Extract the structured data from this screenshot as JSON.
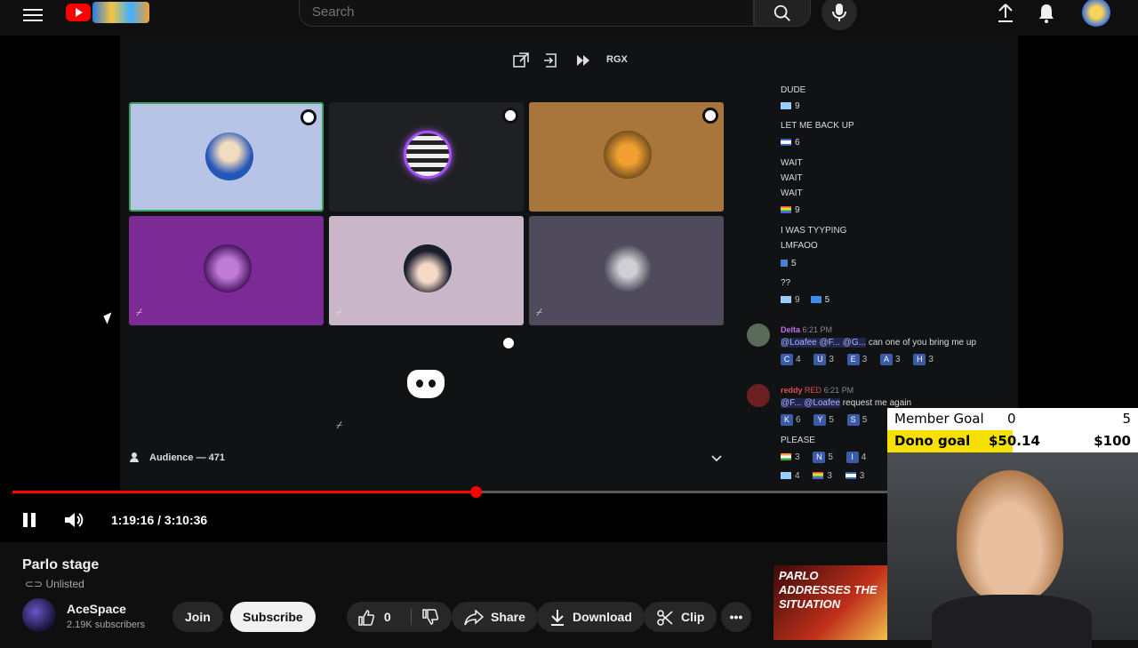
{
  "header": {
    "search_placeholder": "Search"
  },
  "discord": {
    "toolbar_label": "RGX",
    "audience_label": "Audience — 471",
    "tile_colors": [
      "#b8c4e6",
      "#1f2023",
      "#a8753a",
      "#7b2a96",
      "#c9b6c8",
      "#4f4b5c"
    ]
  },
  "chat": {
    "lines": [
      {
        "text": "DUDE"
      },
      {
        "count": "9"
      },
      {
        "text": "LET ME BACK UP"
      },
      {
        "count": "6"
      },
      {
        "text": "WAIT"
      },
      {
        "text": "WAIT"
      },
      {
        "text": "WAIT"
      },
      {
        "count": "9"
      },
      {
        "text": "I WAS TYYPING"
      },
      {
        "text": "LMFAOO"
      },
      {
        "count": "5"
      },
      {
        "text": "??"
      },
      {
        "count": "9",
        "count2": "5"
      }
    ],
    "msg1": {
      "user": "Delta",
      "time": "6:21 PM",
      "mentions": "@Loafee @F... @G...",
      "text": "can one of you bring me up",
      "reactions": [
        [
          "C",
          "4"
        ],
        [
          "U",
          "3"
        ],
        [
          "E",
          "3"
        ],
        [
          "A",
          "3"
        ],
        [
          "H",
          "3"
        ]
      ]
    },
    "msg2": {
      "user": "reddy",
      "role": "RED",
      "time": "6:21 PM",
      "mentions": "@F... @Loafee",
      "text": "request me again",
      "reactions": [
        [
          "K",
          "6"
        ],
        [
          "Y",
          "5"
        ],
        [
          "S",
          "5"
        ]
      ]
    },
    "msg3": {
      "text": "PLEASE",
      "row1": [
        [
          "3"
        ],
        [
          "N",
          "5"
        ],
        [
          "I",
          "4"
        ]
      ],
      "row2": [
        [
          "4"
        ],
        [
          "3"
        ],
        [
          "3"
        ]
      ]
    }
  },
  "goals": {
    "member_label": "Member Goal",
    "member_current": "0",
    "member_target": "5",
    "dono_label": "Dono goal",
    "dono_current": "$50.14",
    "dono_target": "$100"
  },
  "player": {
    "time": "1:19:16 / 3:10:36",
    "progress": 0.416,
    "played_color": "#ff0000"
  },
  "video": {
    "title": "Parlo stage",
    "visibility": "Unlisted",
    "channel": "AceSpace",
    "subscribers": "2.19K subscribers",
    "join_label": "Join",
    "subscribe_label": "Subscribe",
    "likes": "0",
    "share_label": "Share",
    "download_label": "Download",
    "clip_label": "Clip"
  },
  "ad_thumbnail": {
    "text": "PARLO ADDRESSES THE SITUATION"
  }
}
